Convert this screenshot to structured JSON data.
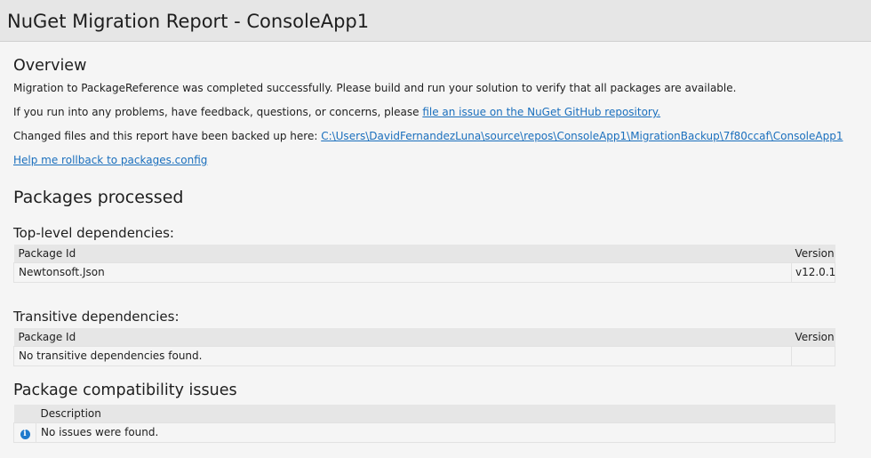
{
  "header": {
    "title": "NuGet Migration Report - ConsoleApp1"
  },
  "overview": {
    "heading": "Overview",
    "line1": "Migration to PackageReference was completed successfully. Please build and run your solution to verify that all packages are available.",
    "line2_prefix": "If you run into any problems, have feedback, questions, or concerns, please ",
    "line2_link": "file an issue on the NuGet GitHub repository.",
    "line3_prefix": "Changed files and this report have been backed up here: ",
    "line3_link": "C:\\Users\\DavidFernandezLuna\\source\\repos\\ConsoleApp1\\MigrationBackup\\7f80ccaf\\ConsoleApp1",
    "rollback_link": "Help me rollback to packages.config"
  },
  "packages": {
    "heading": "Packages processed",
    "top_level": {
      "heading": "Top-level dependencies:",
      "col_id": "Package Id",
      "col_version": "Version",
      "rows": [
        {
          "id": "Newtonsoft.Json",
          "version": "v12.0.1"
        }
      ]
    },
    "transitive": {
      "heading": "Transitive dependencies:",
      "col_id": "Package Id",
      "col_version": "Version",
      "empty_message": "No transitive dependencies found.",
      "empty_version": ""
    }
  },
  "compat": {
    "heading": "Package compatibility issues",
    "col_desc": "Description",
    "icon": "info-icon",
    "icon_glyph": "i",
    "message": "No issues were found."
  }
}
